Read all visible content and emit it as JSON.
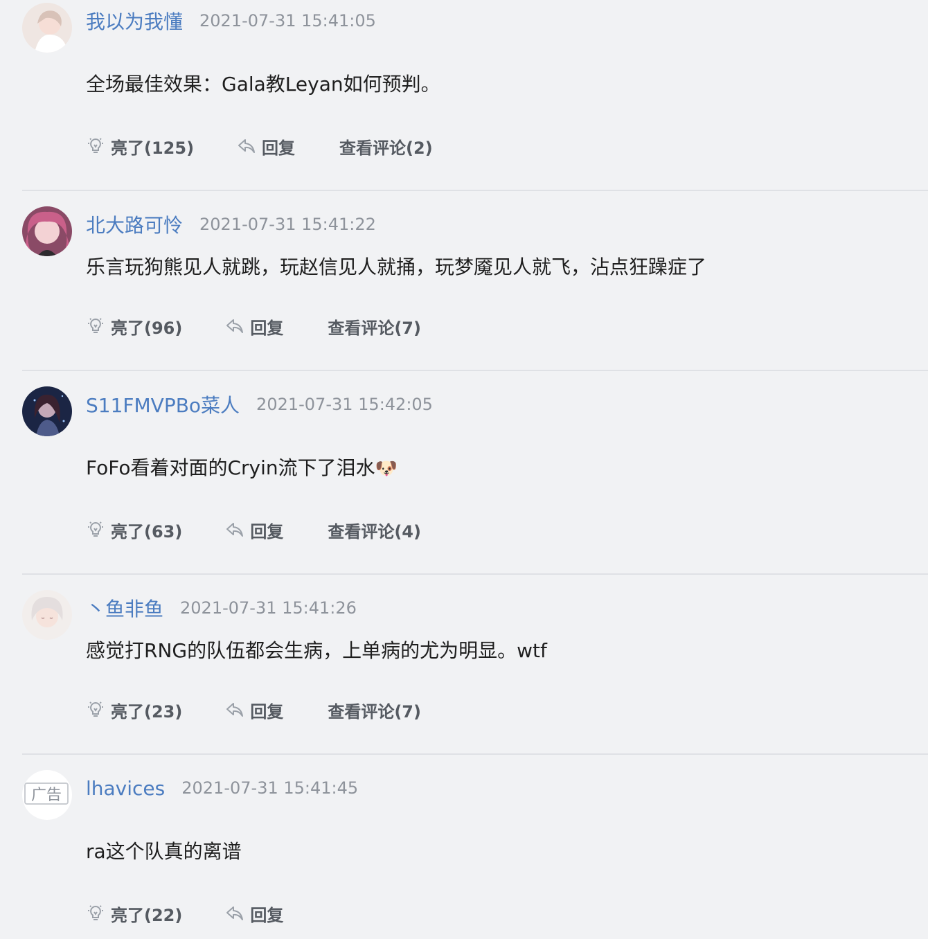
{
  "comments": [
    {
      "username": "我以为我懂",
      "time": "2021-07-31 15:41:05",
      "text": "全场最佳效果：Gala教Leyan如何预判。",
      "like_label": "亮了(125)",
      "reply_label": "回复",
      "view_label": "查看评论(2)"
    },
    {
      "username": "北大路可怜",
      "time": "2021-07-31 15:41:22",
      "text": "乐言玩狗熊见人就跳，玩赵信见人就捅，玩梦魇见人就飞，沾点狂躁症了",
      "like_label": "亮了(96)",
      "reply_label": "回复",
      "view_label": "查看评论(7)"
    },
    {
      "username": "S11FMVPBo菜人",
      "time": "2021-07-31 15:42:05",
      "text": "FoFo看着对面的Cryin流下了泪水",
      "emoji": "🐶",
      "like_label": "亮了(63)",
      "reply_label": "回复",
      "view_label": "查看评论(4)"
    },
    {
      "username": "丶鱼非鱼",
      "time": "2021-07-31 15:41:26",
      "text": "感觉打RNG的队伍都会生病，上单病的尤为明显。wtf",
      "like_label": "亮了(23)",
      "reply_label": "回复",
      "view_label": "查看评论(7)"
    },
    {
      "username": "lhavices",
      "time": "2021-07-31 15:41:45",
      "avatar_label": "广告",
      "text": "ra这个队真的离谱",
      "like_label": "亮了(22)",
      "reply_label": "回复"
    }
  ],
  "icons": {
    "like": "lightbulb-icon",
    "reply": "reply-arrow-icon"
  },
  "colors": {
    "background": "#f1f2f4",
    "username": "#4b7cc0",
    "timestamp": "#8e939b",
    "action": "#555a61",
    "divider": "#dfe1e5"
  }
}
